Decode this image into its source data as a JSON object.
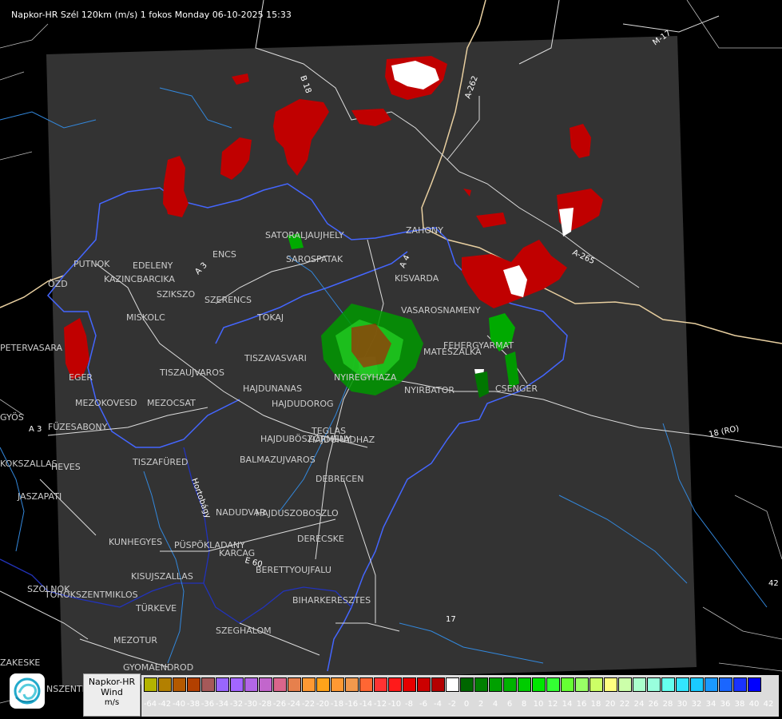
{
  "header": {
    "title": "Napkor-HR Szél 120km (m/s) 1 fokos Monday 06-10-2025 15:33"
  },
  "legend": {
    "line1": "Napkor-HR",
    "line2": "Wind",
    "line3": "m/s",
    "ticks": [
      "-64",
      "-42",
      "-40",
      "-38",
      "-36",
      "-34",
      "-32",
      "-30",
      "-28",
      "-26",
      "-24",
      "-22",
      "-20",
      "-18",
      "-16",
      "-14",
      "-12",
      "-10",
      "-8",
      "-6",
      "-4",
      "-2",
      "0",
      "2",
      "4",
      "6",
      "8",
      "10",
      "12",
      "14",
      "16",
      "18",
      "20",
      "22",
      "24",
      "26",
      "28",
      "30",
      "32",
      "34",
      "36",
      "38",
      "40",
      "42"
    ],
    "colors": [
      "#b3b300",
      "#b38000",
      "#b35900",
      "#b34000",
      "#a65959",
      "#9966ff",
      "#a366ff",
      "#b266e6",
      "#c266cc",
      "#d9668c",
      "#e6804d",
      "#ff9933",
      "#ffa31a",
      "#ff9933",
      "#f2994d",
      "#ff6633",
      "#ff3333",
      "#ff1a1a",
      "#e60000",
      "#cc0000",
      "#b30000",
      "#ffffff",
      "#006600",
      "#008000",
      "#00a000",
      "#00b300",
      "#00cc00",
      "#00e600",
      "#33ff33",
      "#66ff33",
      "#99ff66",
      "#ccff66",
      "#ffff80",
      "#ccffaa",
      "#aaffcc",
      "#99ffdd",
      "#66ffee",
      "#33e6ff",
      "#1acaff",
      "#1a99ff",
      "#1a66ff",
      "#1a33ff",
      "#0000ff"
    ]
  },
  "map": {
    "towns": [
      {
        "name": "SATORALJAUJHELY"
      },
      {
        "name": "SAROSPATAK"
      },
      {
        "name": "ZAHONY"
      },
      {
        "name": "PUTNOK"
      },
      {
        "name": "EDELENY"
      },
      {
        "name": "KAZINCBARCIKA"
      },
      {
        "name": "ENCS"
      },
      {
        "name": "SZIKSZO"
      },
      {
        "name": "SZERENCS"
      },
      {
        "name": "KISVARDA"
      },
      {
        "name": "TOKAJ"
      },
      {
        "name": "VASAROSNAMENY"
      },
      {
        "name": "MISKOLC"
      },
      {
        "name": "FEHERGYARMAT"
      },
      {
        "name": "MATESZALKA"
      },
      {
        "name": "PETERVASARA"
      },
      {
        "name": "EGER"
      },
      {
        "name": "TISZAVASVARI"
      },
      {
        "name": "TISZAUJVAROS"
      },
      {
        "name": "NYIREGYHAZA"
      },
      {
        "name": "HAJDUNANAS"
      },
      {
        "name": "CSENGER"
      },
      {
        "name": "NYIRBATOR"
      },
      {
        "name": "MEZOKOVESD"
      },
      {
        "name": "MEZOCSAT"
      },
      {
        "name": "HAJDUDOROG"
      },
      {
        "name": "GYÖS"
      },
      {
        "name": "FÜZESABONY"
      },
      {
        "name": "TEGLAS"
      },
      {
        "name": "HAJDUBÖSZÖRMENY"
      },
      {
        "name": "HAJDUHADHAZ"
      },
      {
        "name": "HEVES"
      },
      {
        "name": "TISZAFÜRED"
      },
      {
        "name": "BALMAZUJVAROS"
      },
      {
        "name": "DEBRECEN"
      },
      {
        "name": "JASZAPATI"
      },
      {
        "name": "NADUDVAR"
      },
      {
        "name": "HAJDUSZOBOSZLO"
      },
      {
        "name": "DERECSKE"
      },
      {
        "name": "KUNHEGYES"
      },
      {
        "name": "PÜSPÖKLADANY"
      },
      {
        "name": "KARCAG"
      },
      {
        "name": "BERETTYOUJFALU"
      },
      {
        "name": "KISUJSZALLAS"
      },
      {
        "name": "SZOLNOK"
      },
      {
        "name": "TÖRÖKSZENTMIKLOS"
      },
      {
        "name": "BIHARKERESZTES"
      },
      {
        "name": "TÜRKEVE"
      },
      {
        "name": "SZEGHALOM"
      },
      {
        "name": "MEZOTUR"
      },
      {
        "name": "GYOMAENDROD"
      },
      {
        "name": "KOKSZALLAS"
      },
      {
        "name": "ZAKESKE"
      },
      {
        "name": "NSZENTMI"
      },
      {
        "name": "ÖZD"
      }
    ],
    "roads": [
      {
        "name": "B 18"
      },
      {
        "name": "A-262"
      },
      {
        "name": "M-17"
      },
      {
        "name": "A-265"
      },
      {
        "name": "A 3"
      },
      {
        "name": "A 4"
      },
      {
        "name": "18 (RO)"
      },
      {
        "name": "E 60"
      },
      {
        "name": "42"
      },
      {
        "name": "17"
      },
      {
        "name": "Hortobágy"
      }
    ]
  }
}
